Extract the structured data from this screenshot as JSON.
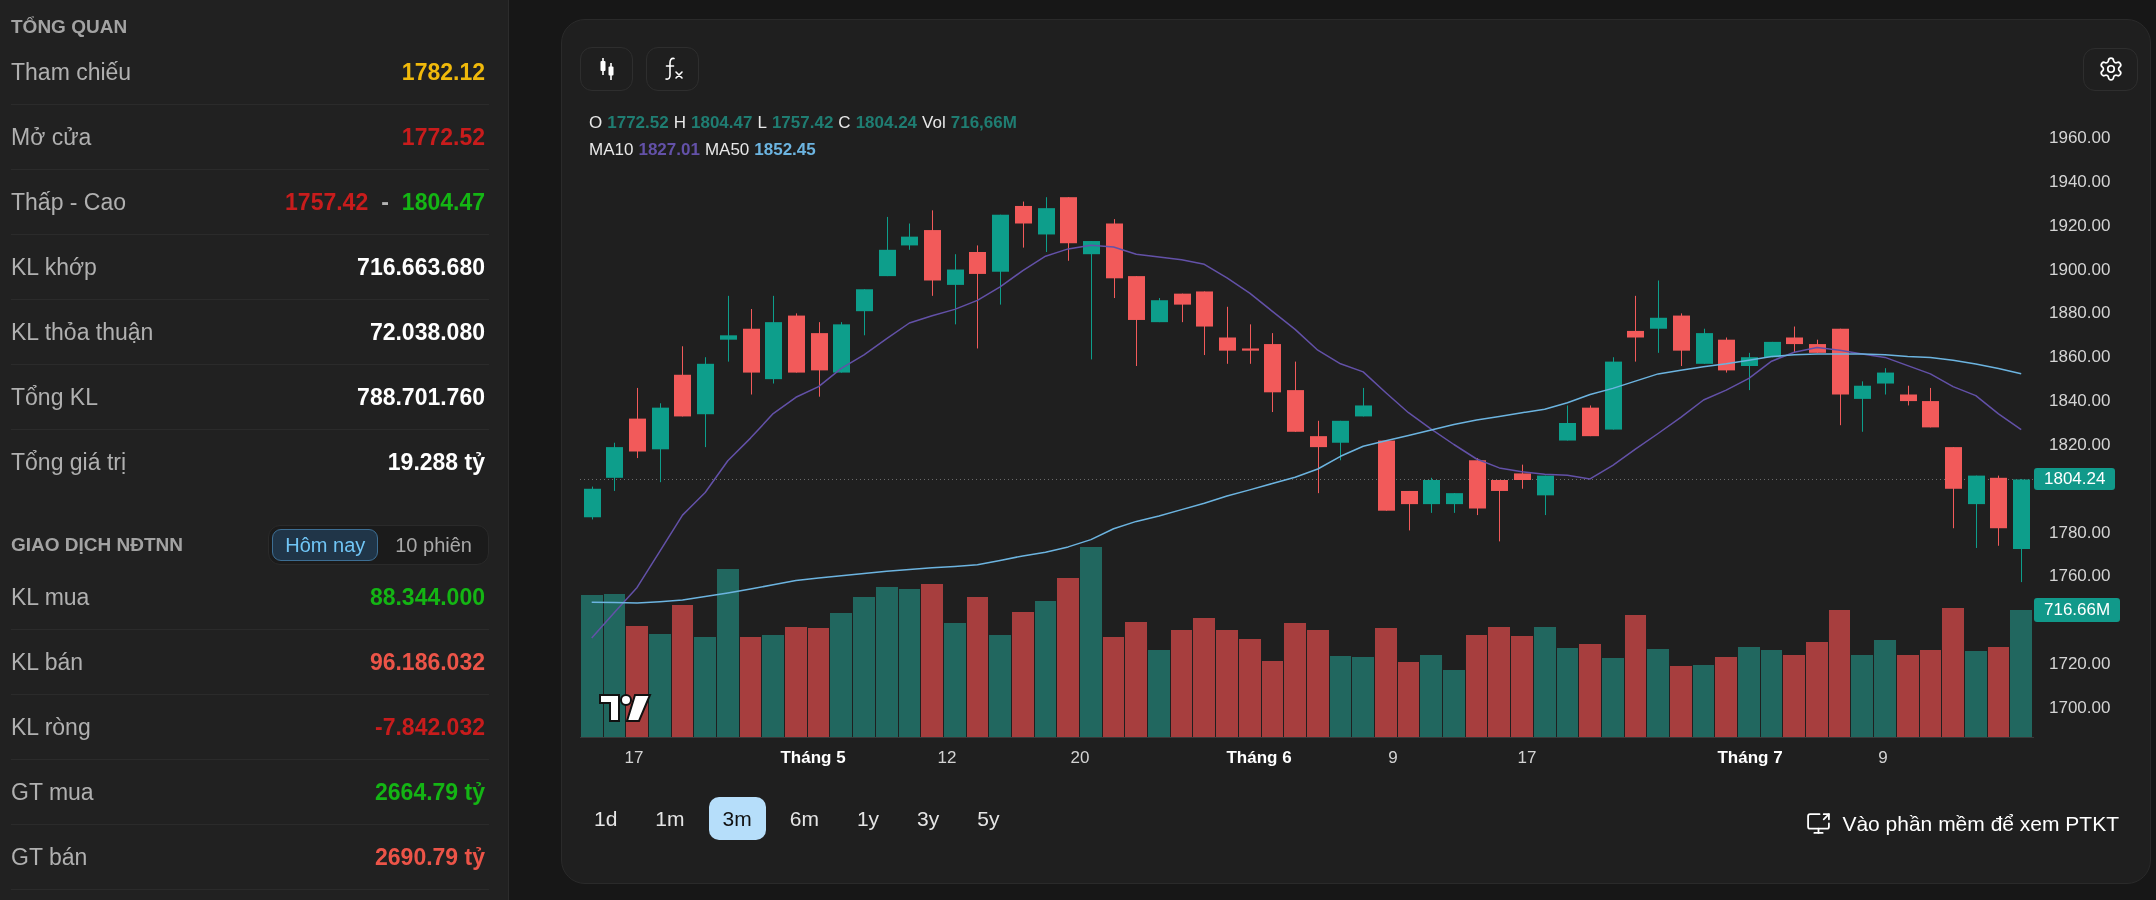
{
  "overview": {
    "title": "TỔNG QUAN",
    "rows": [
      {
        "kind": "value",
        "label": "Tham chiếu",
        "value": {
          "text": "1782.12",
          "color": "#f0b90b"
        }
      },
      {
        "kind": "value",
        "label": "Mở cửa",
        "value": {
          "text": "1772.52",
          "color": "#c81c1c"
        }
      },
      {
        "kind": "range",
        "label": "Thấp - Cao",
        "low": {
          "text": "1757.42",
          "color": "#c81c1c"
        },
        "separator": "-",
        "high": {
          "text": "1804.47",
          "color": "#14b514"
        }
      },
      {
        "kind": "value",
        "label": "KL khớp",
        "value": {
          "text": "716.663.680",
          "color": "#ffffff"
        }
      },
      {
        "kind": "value",
        "label": "KL thỏa thuận",
        "value": {
          "text": "72.038.080",
          "color": "#ffffff"
        }
      },
      {
        "kind": "value",
        "label": "Tổng KL",
        "value": {
          "text": "788.701.760",
          "color": "#ffffff"
        }
      },
      {
        "kind": "value",
        "label": "Tổng giá trị",
        "value": {
          "text": "19.288 tỷ",
          "color": "#ffffff"
        }
      }
    ]
  },
  "foreign_trading": {
    "title": "GIAO DỊCH NĐTNN",
    "tabs": [
      {
        "label": "Hôm nay",
        "selected": true
      },
      {
        "label": "10 phiên",
        "selected": false
      }
    ],
    "rows": [
      {
        "kind": "value",
        "label": "KL mua",
        "value": {
          "text": "88.344.000",
          "color": "#14b514"
        }
      },
      {
        "kind": "value",
        "label": "KL bán",
        "value": {
          "text": "96.186.032",
          "color": "#ec5448"
        }
      },
      {
        "kind": "value",
        "label": "KL ròng",
        "value": {
          "text": "-7.842.032",
          "color": "#c81c1c"
        }
      },
      {
        "kind": "value",
        "label": "GT mua",
        "value": {
          "text": "2664.79 tỷ",
          "color": "#14b514"
        }
      },
      {
        "kind": "value",
        "label": "GT bán",
        "value": {
          "text": "2690.79 tỷ",
          "color": "#ec5448"
        }
      }
    ]
  },
  "chart": {
    "legend": {
      "ohlc": [
        {
          "label": "O",
          "value": "1772.52"
        },
        {
          "label": "H",
          "value": "1804.47"
        },
        {
          "label": "L",
          "value": "1757.42"
        },
        {
          "label": "C",
          "value": "1804.24"
        },
        {
          "label": "Vol",
          "value": "716,66M"
        }
      ],
      "moving_averages": [
        {
          "label": "MA10",
          "value": "1827.01",
          "color": "#6351a8"
        },
        {
          "label": "MA50",
          "value": "1852.45",
          "color": "#6cb4e0"
        }
      ]
    },
    "chart_data": {
      "type": "line",
      "ylim": [
        1700,
        1960
      ],
      "yticks": [
        {
          "value": 1960,
          "label": "1960.00"
        },
        {
          "value": 1940,
          "label": "1940.00"
        },
        {
          "value": 1920,
          "label": "1920.00"
        },
        {
          "value": 1900,
          "label": "1900.00"
        },
        {
          "value": 1880,
          "label": "1880.00"
        },
        {
          "value": 1860,
          "label": "1860.00"
        },
        {
          "value": 1840,
          "label": "1840.00"
        },
        {
          "value": 1820,
          "label": "1820.00"
        },
        {
          "value": 1780,
          "label": "1780.00"
        },
        {
          "value": 1760,
          "label": "1760.00"
        },
        {
          "value": 1720,
          "label": "1720.00"
        },
        {
          "value": 1700,
          "label": "1700.00"
        }
      ],
      "series": [
        {
          "color": "#6351a8",
          "values": [
            1731.9,
            1743.5,
            1755.0,
            1771.5,
            1788.0,
            1798.3,
            1812.8,
            1823.1,
            1834.3,
            1841.7,
            1846.6,
            1854.9,
            1861.1,
            1868.5,
            1875.6,
            1878.9,
            1881.8,
            1885.9,
            1892.1,
            1899.5,
            1906.1,
            1909.4,
            1911.1,
            1910.3,
            1907.0,
            1905.7,
            1904.5,
            1902.4,
            1896.2,
            1889.2,
            1880.9,
            1872.7,
            1863.2,
            1857.0,
            1853.3,
            1843.8,
            1834.7,
            1827.2,
            1820.2,
            1813.6,
            1809.5,
            1807.8,
            1806.6,
            1806.2,
            1804.5,
            1810.7,
            1818.1,
            1825.2,
            1832.6,
            1840.5,
            1845.0,
            1850.4,
            1858.2,
            1862.3,
            1864.4,
            1863.2,
            1861.5,
            1859.9,
            1856.2,
            1852.4,
            1846.6,
            1842.5,
            1834.2,
            1827.0
          ]
        },
        {
          "color": "#6cb4e0",
          "values": [
            1748.2,
            1748.1,
            1747.9,
            1748.5,
            1749.2,
            1750.8,
            1752.5,
            1754.3,
            1756.2,
            1758.2,
            1759.3,
            1760.3,
            1761.3,
            1762.4,
            1763.2,
            1764.0,
            1764.6,
            1765.3,
            1767.3,
            1769.4,
            1771.0,
            1773.5,
            1776.8,
            1781.8,
            1785.1,
            1787.6,
            1790.5,
            1793.4,
            1796.7,
            1799.5,
            1802.4,
            1805.3,
            1809.0,
            1814.8,
            1819.4,
            1821.9,
            1824.3,
            1826.8,
            1829.3,
            1831.4,
            1833.0,
            1834.7,
            1836.3,
            1839.2,
            1843.0,
            1845.8,
            1849.1,
            1852.4,
            1854.1,
            1855.7,
            1857.0,
            1858.6,
            1860.3,
            1861.1,
            1861.5,
            1861.5,
            1861.5,
            1861.1,
            1860.3,
            1859.9,
            1858.6,
            1856.9,
            1854.8,
            1852.5
          ]
        }
      ]
    },
    "price_tag": "1804.24",
    "volume_tag": "716.66M",
    "time_axis": [
      {
        "label": "17",
        "kind": "day"
      },
      {
        "label": "Tháng 5",
        "kind": "month"
      },
      {
        "label": "12",
        "kind": "day"
      },
      {
        "label": "20",
        "kind": "day"
      },
      {
        "label": "Tháng 6",
        "kind": "month"
      },
      {
        "label": "9",
        "kind": "day"
      },
      {
        "label": "17",
        "kind": "day"
      },
      {
        "label": "Tháng 7",
        "kind": "month"
      },
      {
        "label": "9",
        "kind": "day"
      }
    ],
    "ranges": [
      {
        "label": "1d",
        "selected": false
      },
      {
        "label": "1m",
        "selected": false
      },
      {
        "label": "3m",
        "selected": true
      },
      {
        "label": "6m",
        "selected": false
      },
      {
        "label": "1y",
        "selected": false
      },
      {
        "label": "3y",
        "selected": false
      },
      {
        "label": "5y",
        "selected": false
      }
    ],
    "desktop_link": "Vào phần mềm để xem PTKT"
  }
}
